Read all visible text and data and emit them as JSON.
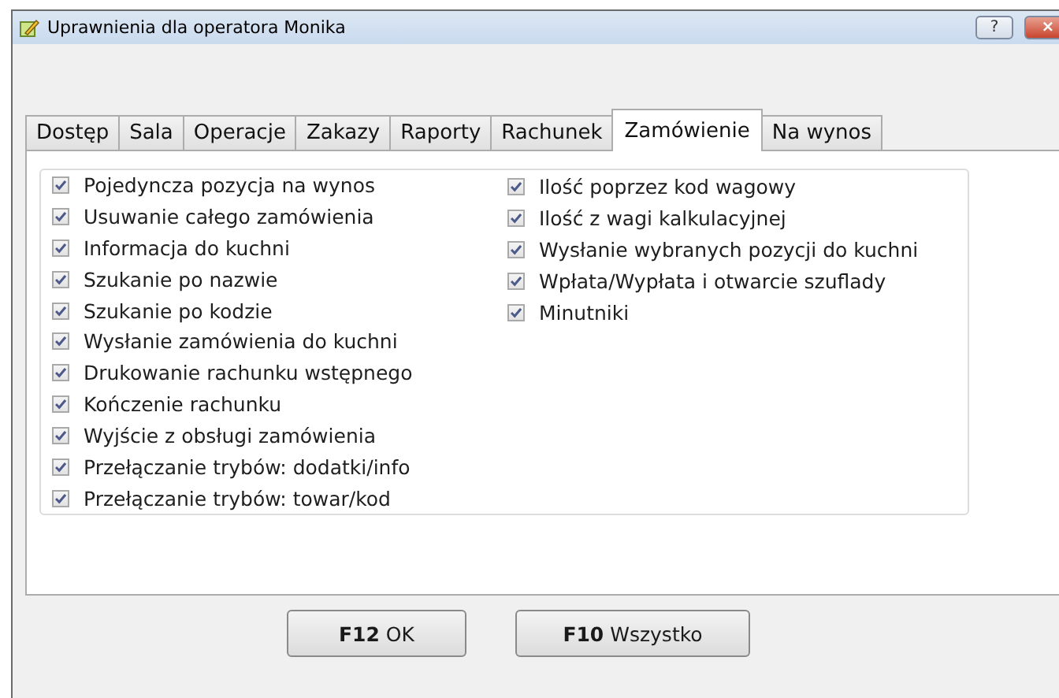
{
  "window": {
    "title": "Uprawnienia dla operatora Monika",
    "help_button": "?",
    "close_button": "×"
  },
  "tabs": [
    {
      "label": "Dostęp",
      "selected": false
    },
    {
      "label": "Sala",
      "selected": false
    },
    {
      "label": "Operacje",
      "selected": false
    },
    {
      "label": "Zakazy",
      "selected": false
    },
    {
      "label": "Raporty",
      "selected": false
    },
    {
      "label": "Rachunek",
      "selected": false
    },
    {
      "label": "Zamówienie",
      "selected": true
    },
    {
      "label": "Na wynos",
      "selected": false
    }
  ],
  "columns": [
    [
      {
        "label": "Pojedyncza pozycja na wynos",
        "checked": true
      },
      {
        "label": "Usuwanie całego zamówienia",
        "checked": true
      },
      {
        "label": "Informacja do kuchni",
        "checked": true
      },
      {
        "label": "Szukanie po nazwie",
        "checked": true
      },
      {
        "label": "Szukanie po kodzie",
        "checked": true
      },
      {
        "label": "Wysłanie zamówienia do kuchni",
        "checked": true
      },
      {
        "label": "Drukowanie rachunku wstępnego",
        "checked": true
      },
      {
        "label": "Kończenie rachunku",
        "checked": true
      },
      {
        "label": "Wyjście z obsługi zamówienia",
        "checked": true
      },
      {
        "label": "Przełączanie trybów: dodatki/info",
        "checked": true
      },
      {
        "label": "Przełączanie trybów: towar/kod",
        "checked": true
      }
    ],
    [
      {
        "label": "Ilość poprzez kod wagowy",
        "checked": true
      },
      {
        "label": "Ilość z wagi kalkulacyjnej",
        "checked": true
      },
      {
        "label": "Wysłanie wybranych pozycji do kuchni",
        "checked": true
      },
      {
        "label": "Wpłata/Wypłata i otwarcie szuflady",
        "checked": true
      },
      {
        "label": "Minutniki",
        "checked": true
      }
    ]
  ],
  "buttons": [
    "**F12** OK",
    "**F10** Wszystko"
  ]
}
